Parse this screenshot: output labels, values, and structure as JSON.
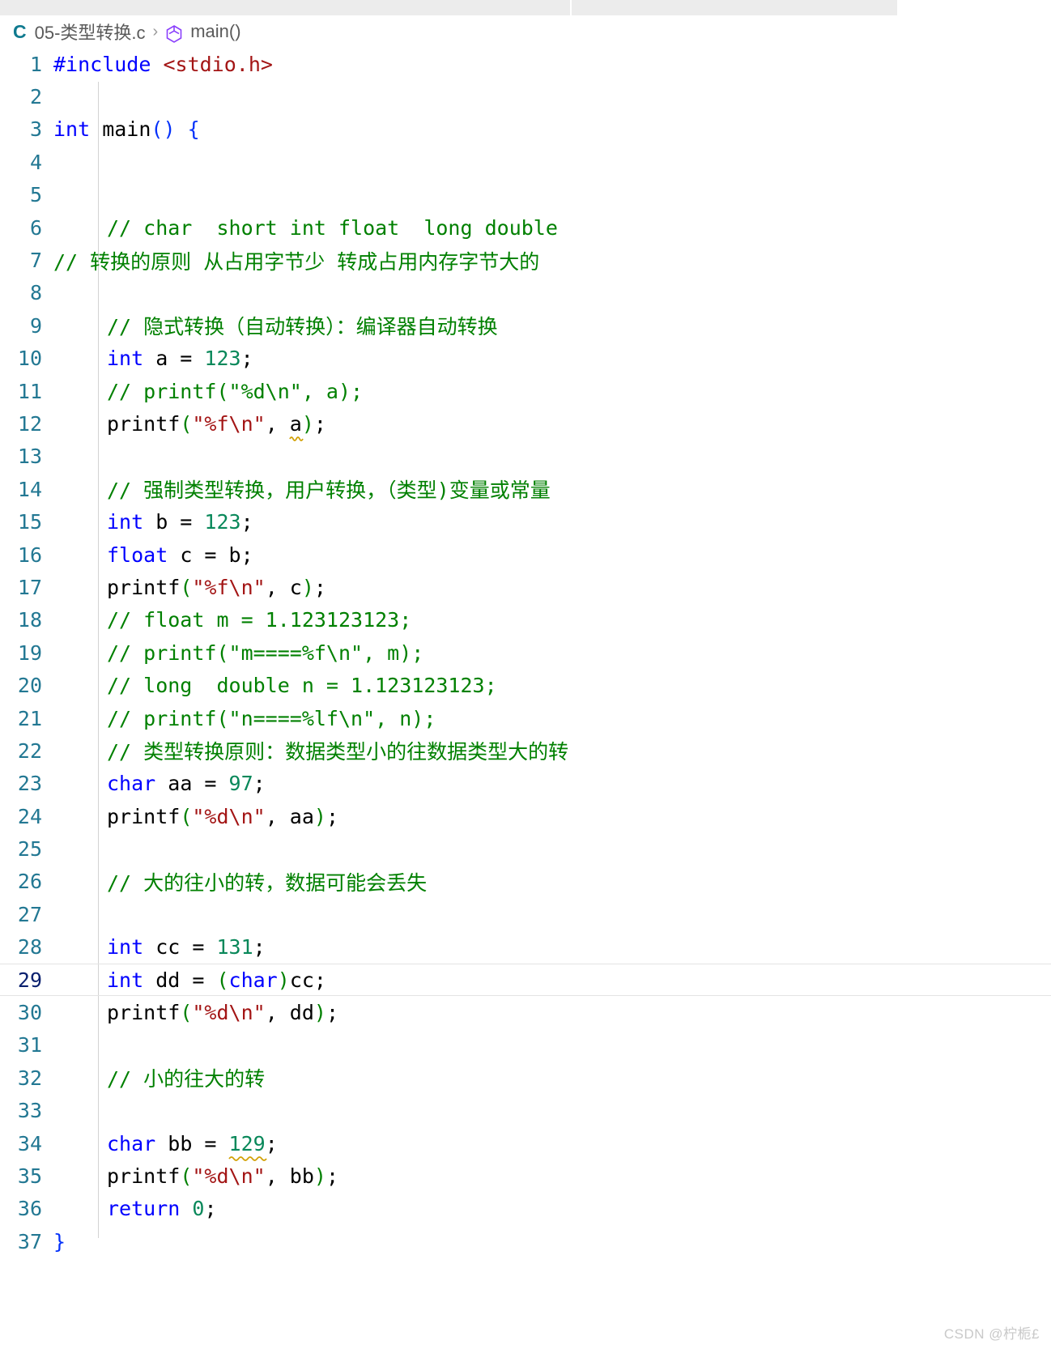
{
  "window": {
    "tabs_visible": false
  },
  "breadcrumb": {
    "language_badge": "C",
    "file_name": "05-类型转换.c",
    "separator": "›",
    "symbol_icon": "symbol-method-icon",
    "symbol_name": "main()"
  },
  "editor": {
    "language": "c",
    "active_line": 29,
    "first_visible_line": 1,
    "last_visible_line": 37,
    "colors": {
      "keyword": "#0000ff",
      "comment": "#008000",
      "string": "#a31515",
      "number": "#09885a",
      "plain": "#000000",
      "line_number": "#237893",
      "active_line_number": "#0b216f",
      "background": "#ffffff",
      "active_line_border": "#e4e4e4",
      "indent_guide": "#d3d3d3",
      "warning_squiggle": "#d2a106",
      "breadcrumb_text": "#616161",
      "c_badge": "#0f7a8f",
      "symbol_icon": "#8a3ffc"
    },
    "lines": [
      {
        "n": "1",
        "indent": 0,
        "text": "#include <stdio.h>"
      },
      {
        "n": "2",
        "indent": 0,
        "text": ""
      },
      {
        "n": "3",
        "indent": 0,
        "text": "int main() {"
      },
      {
        "n": "4",
        "indent": 0,
        "text": ""
      },
      {
        "n": "5",
        "indent": 0,
        "text": ""
      },
      {
        "n": "6",
        "indent": 1,
        "text": "// char  short int float  long double"
      },
      {
        "n": "7",
        "indent": 0,
        "text": "// 转换的原则 从占用字节少 转成占用内存字节大的"
      },
      {
        "n": "8",
        "indent": 0,
        "text": ""
      },
      {
        "n": "9",
        "indent": 1,
        "text": "// 隐式转换（自动转换）：编译器自动转换"
      },
      {
        "n": "10",
        "indent": 1,
        "text": "int a = 123;"
      },
      {
        "n": "11",
        "indent": 1,
        "text": "// printf(\"%d\\n\", a);"
      },
      {
        "n": "12",
        "indent": 1,
        "text": "printf(\"%f\\n\", a);"
      },
      {
        "n": "13",
        "indent": 0,
        "text": ""
      },
      {
        "n": "14",
        "indent": 1,
        "text": "// 强制类型转换，用户转换，（类型)变量或常量"
      },
      {
        "n": "15",
        "indent": 1,
        "text": "int b = 123;"
      },
      {
        "n": "16",
        "indent": 1,
        "text": "float c = b;"
      },
      {
        "n": "17",
        "indent": 1,
        "text": "printf(\"%f\\n\", c);"
      },
      {
        "n": "18",
        "indent": 1,
        "text": "// float m = 1.123123123;"
      },
      {
        "n": "19",
        "indent": 1,
        "text": "// printf(\"m====%f\\n\", m);"
      },
      {
        "n": "20",
        "indent": 1,
        "text": "// long  double n = 1.123123123;"
      },
      {
        "n": "21",
        "indent": 1,
        "text": "// printf(\"n====%lf\\n\", n);"
      },
      {
        "n": "22",
        "indent": 1,
        "text": "// 类型转换原则：数据类型小的往数据类型大的转"
      },
      {
        "n": "23",
        "indent": 1,
        "text": "char aa = 97;"
      },
      {
        "n": "24",
        "indent": 1,
        "text": "printf(\"%d\\n\", aa);"
      },
      {
        "n": "25",
        "indent": 0,
        "text": ""
      },
      {
        "n": "26",
        "indent": 1,
        "text": "// 大的往小的转，数据可能会丢失"
      },
      {
        "n": "27",
        "indent": 0,
        "text": ""
      },
      {
        "n": "28",
        "indent": 1,
        "text": "int cc = 131;"
      },
      {
        "n": "29",
        "indent": 1,
        "text": "int dd = (char)cc;"
      },
      {
        "n": "30",
        "indent": 1,
        "text": "printf(\"%d\\n\", dd);"
      },
      {
        "n": "31",
        "indent": 0,
        "text": ""
      },
      {
        "n": "32",
        "indent": 1,
        "text": "// 小的往大的转"
      },
      {
        "n": "33",
        "indent": 0,
        "text": ""
      },
      {
        "n": "34",
        "indent": 1,
        "text": "char bb = 129;"
      },
      {
        "n": "35",
        "indent": 1,
        "text": "printf(\"%d\\n\", bb);"
      },
      {
        "n": "36",
        "indent": 1,
        "text": "return 0;"
      },
      {
        "n": "37",
        "indent": 0,
        "text": "}"
      }
    ],
    "diagnostics": [
      {
        "line": 12,
        "token": "a",
        "severity": "warning"
      },
      {
        "line": 34,
        "token": "129",
        "severity": "warning"
      }
    ]
  },
  "watermark": {
    "text": "CSDN @柠栀£"
  }
}
